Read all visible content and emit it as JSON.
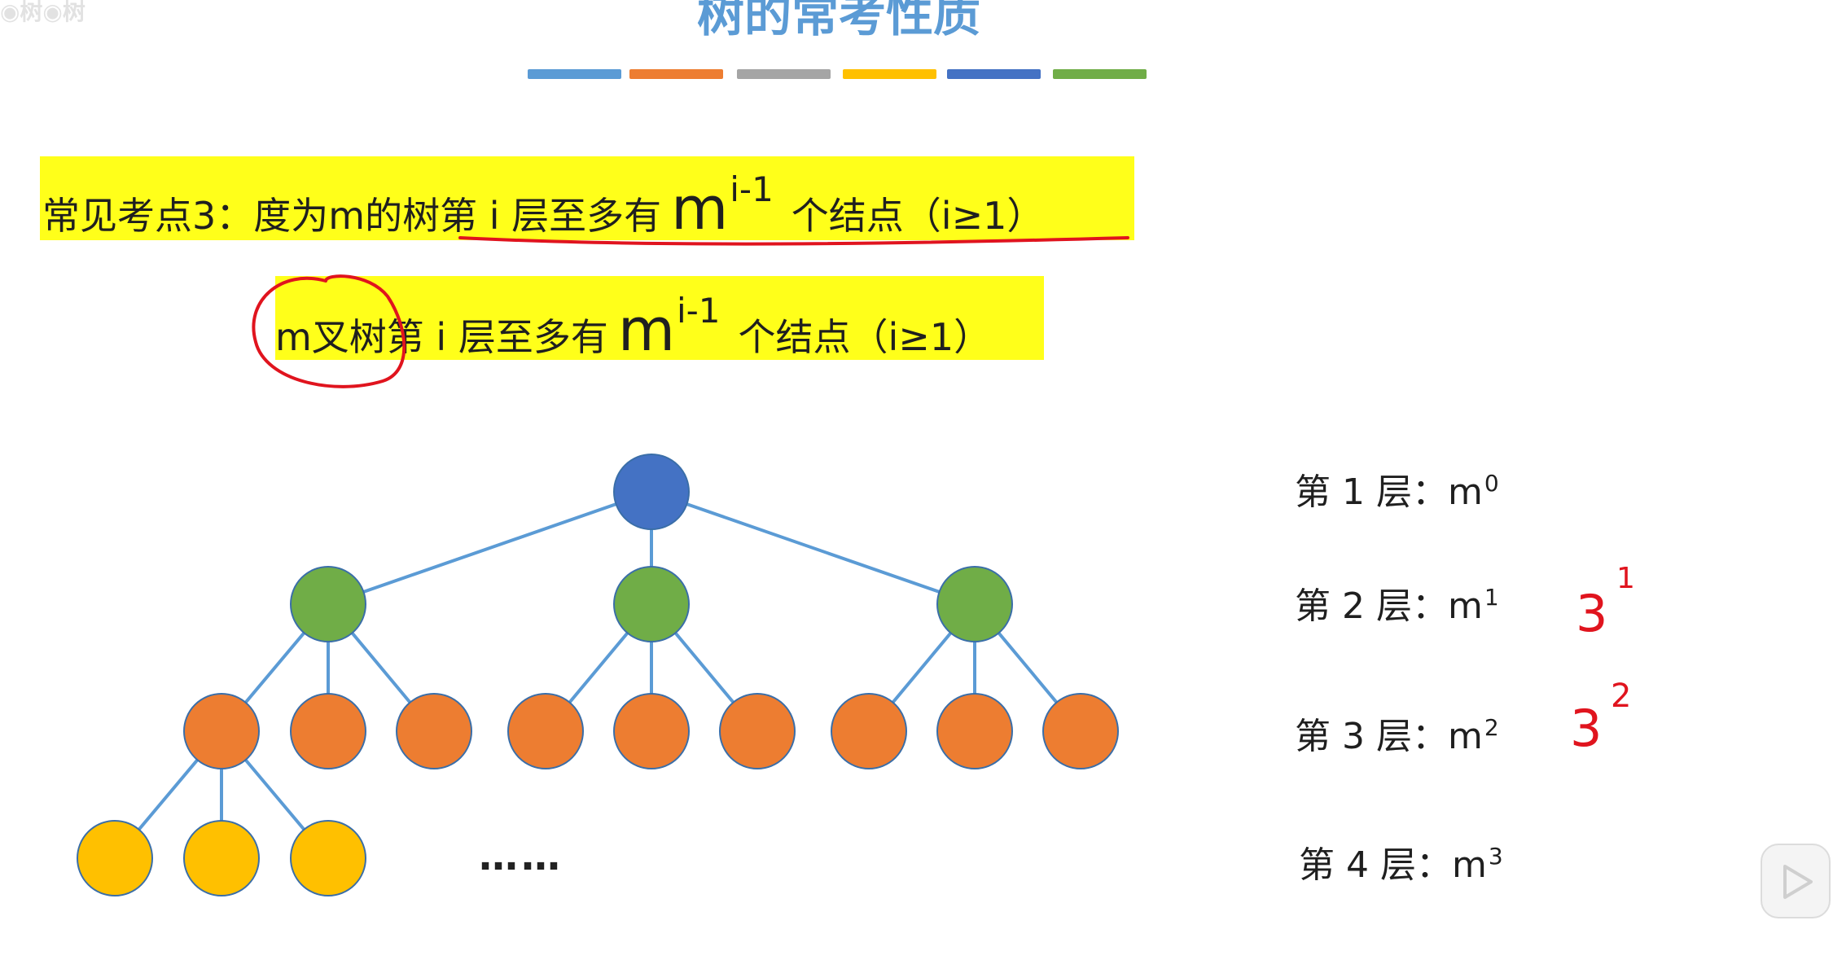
{
  "header": {
    "watermark": "◉树◉树",
    "title": "树的常考性质",
    "color_bar": [
      "#5b9bd5",
      "#ed7d31",
      "#a5a5a5",
      "#ffc000",
      "#4472c4",
      "#70ad47"
    ]
  },
  "property": {
    "line1_lead": "常见考点3：度为m的树第 i 层至多有",
    "line1_base": "m",
    "line1_exp": "i-1",
    "line1_tail": "个结点（i≥1）",
    "line2_lead": "m叉树第 i 层至多有",
    "line2_base": "m",
    "line2_exp": "i-1",
    "line2_tail": "个结点（i≥1）",
    "highlight_color": "#ffff1a",
    "annotation_color": "#e0141e"
  },
  "tree": {
    "levels": [
      {
        "count": 1,
        "color": "#4472c4"
      },
      {
        "count": 3,
        "color": "#70ad47"
      },
      {
        "count": 9,
        "color": "#ed7d31"
      },
      {
        "count": 3,
        "color": "#ffc000"
      }
    ],
    "edge_color": "#5b9bd5",
    "ellipsis": "……"
  },
  "levels_formula": [
    {
      "label": "第 1 层：m",
      "exp": "0"
    },
    {
      "label": "第 2 层：m",
      "exp": "1"
    },
    {
      "label": "第 3 层：m",
      "exp": "2"
    },
    {
      "label": "第 4 层：m",
      "exp": "3"
    }
  ],
  "handwritten": [
    {
      "base": "3",
      "exp": "1"
    },
    {
      "base": "3",
      "exp": "2"
    }
  ],
  "player": {
    "icon": "play-icon"
  }
}
